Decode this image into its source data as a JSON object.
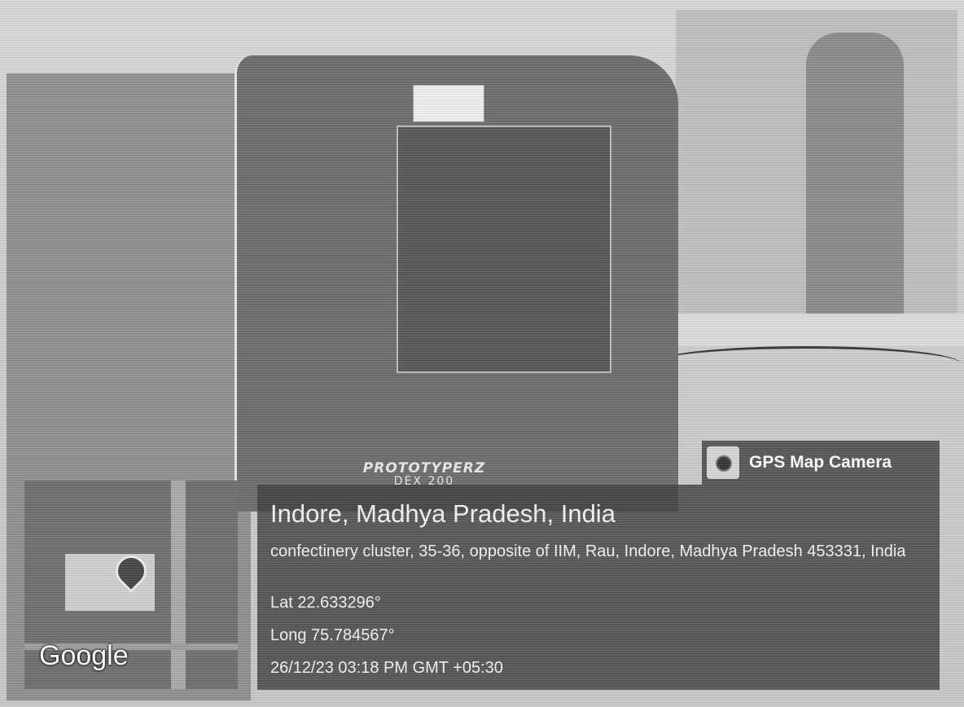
{
  "machine": {
    "brand": "PROTOTYPERZ",
    "model": "DEX 200"
  },
  "map": {
    "provider_logo": "Google"
  },
  "gps_tag": {
    "icon": "camera-icon",
    "title": "GPS Map Camera"
  },
  "location": {
    "city": "Indore, Madhya Pradesh, India",
    "address": "confectinery cluster, 35-36, opposite of IIM, Rau, Indore, Madhya Pradesh 453331, India",
    "latitude": "Lat 22.633296°",
    "longitude": "Long 75.784567°",
    "datetime": "26/12/23 03:18 PM GMT +05:30"
  }
}
